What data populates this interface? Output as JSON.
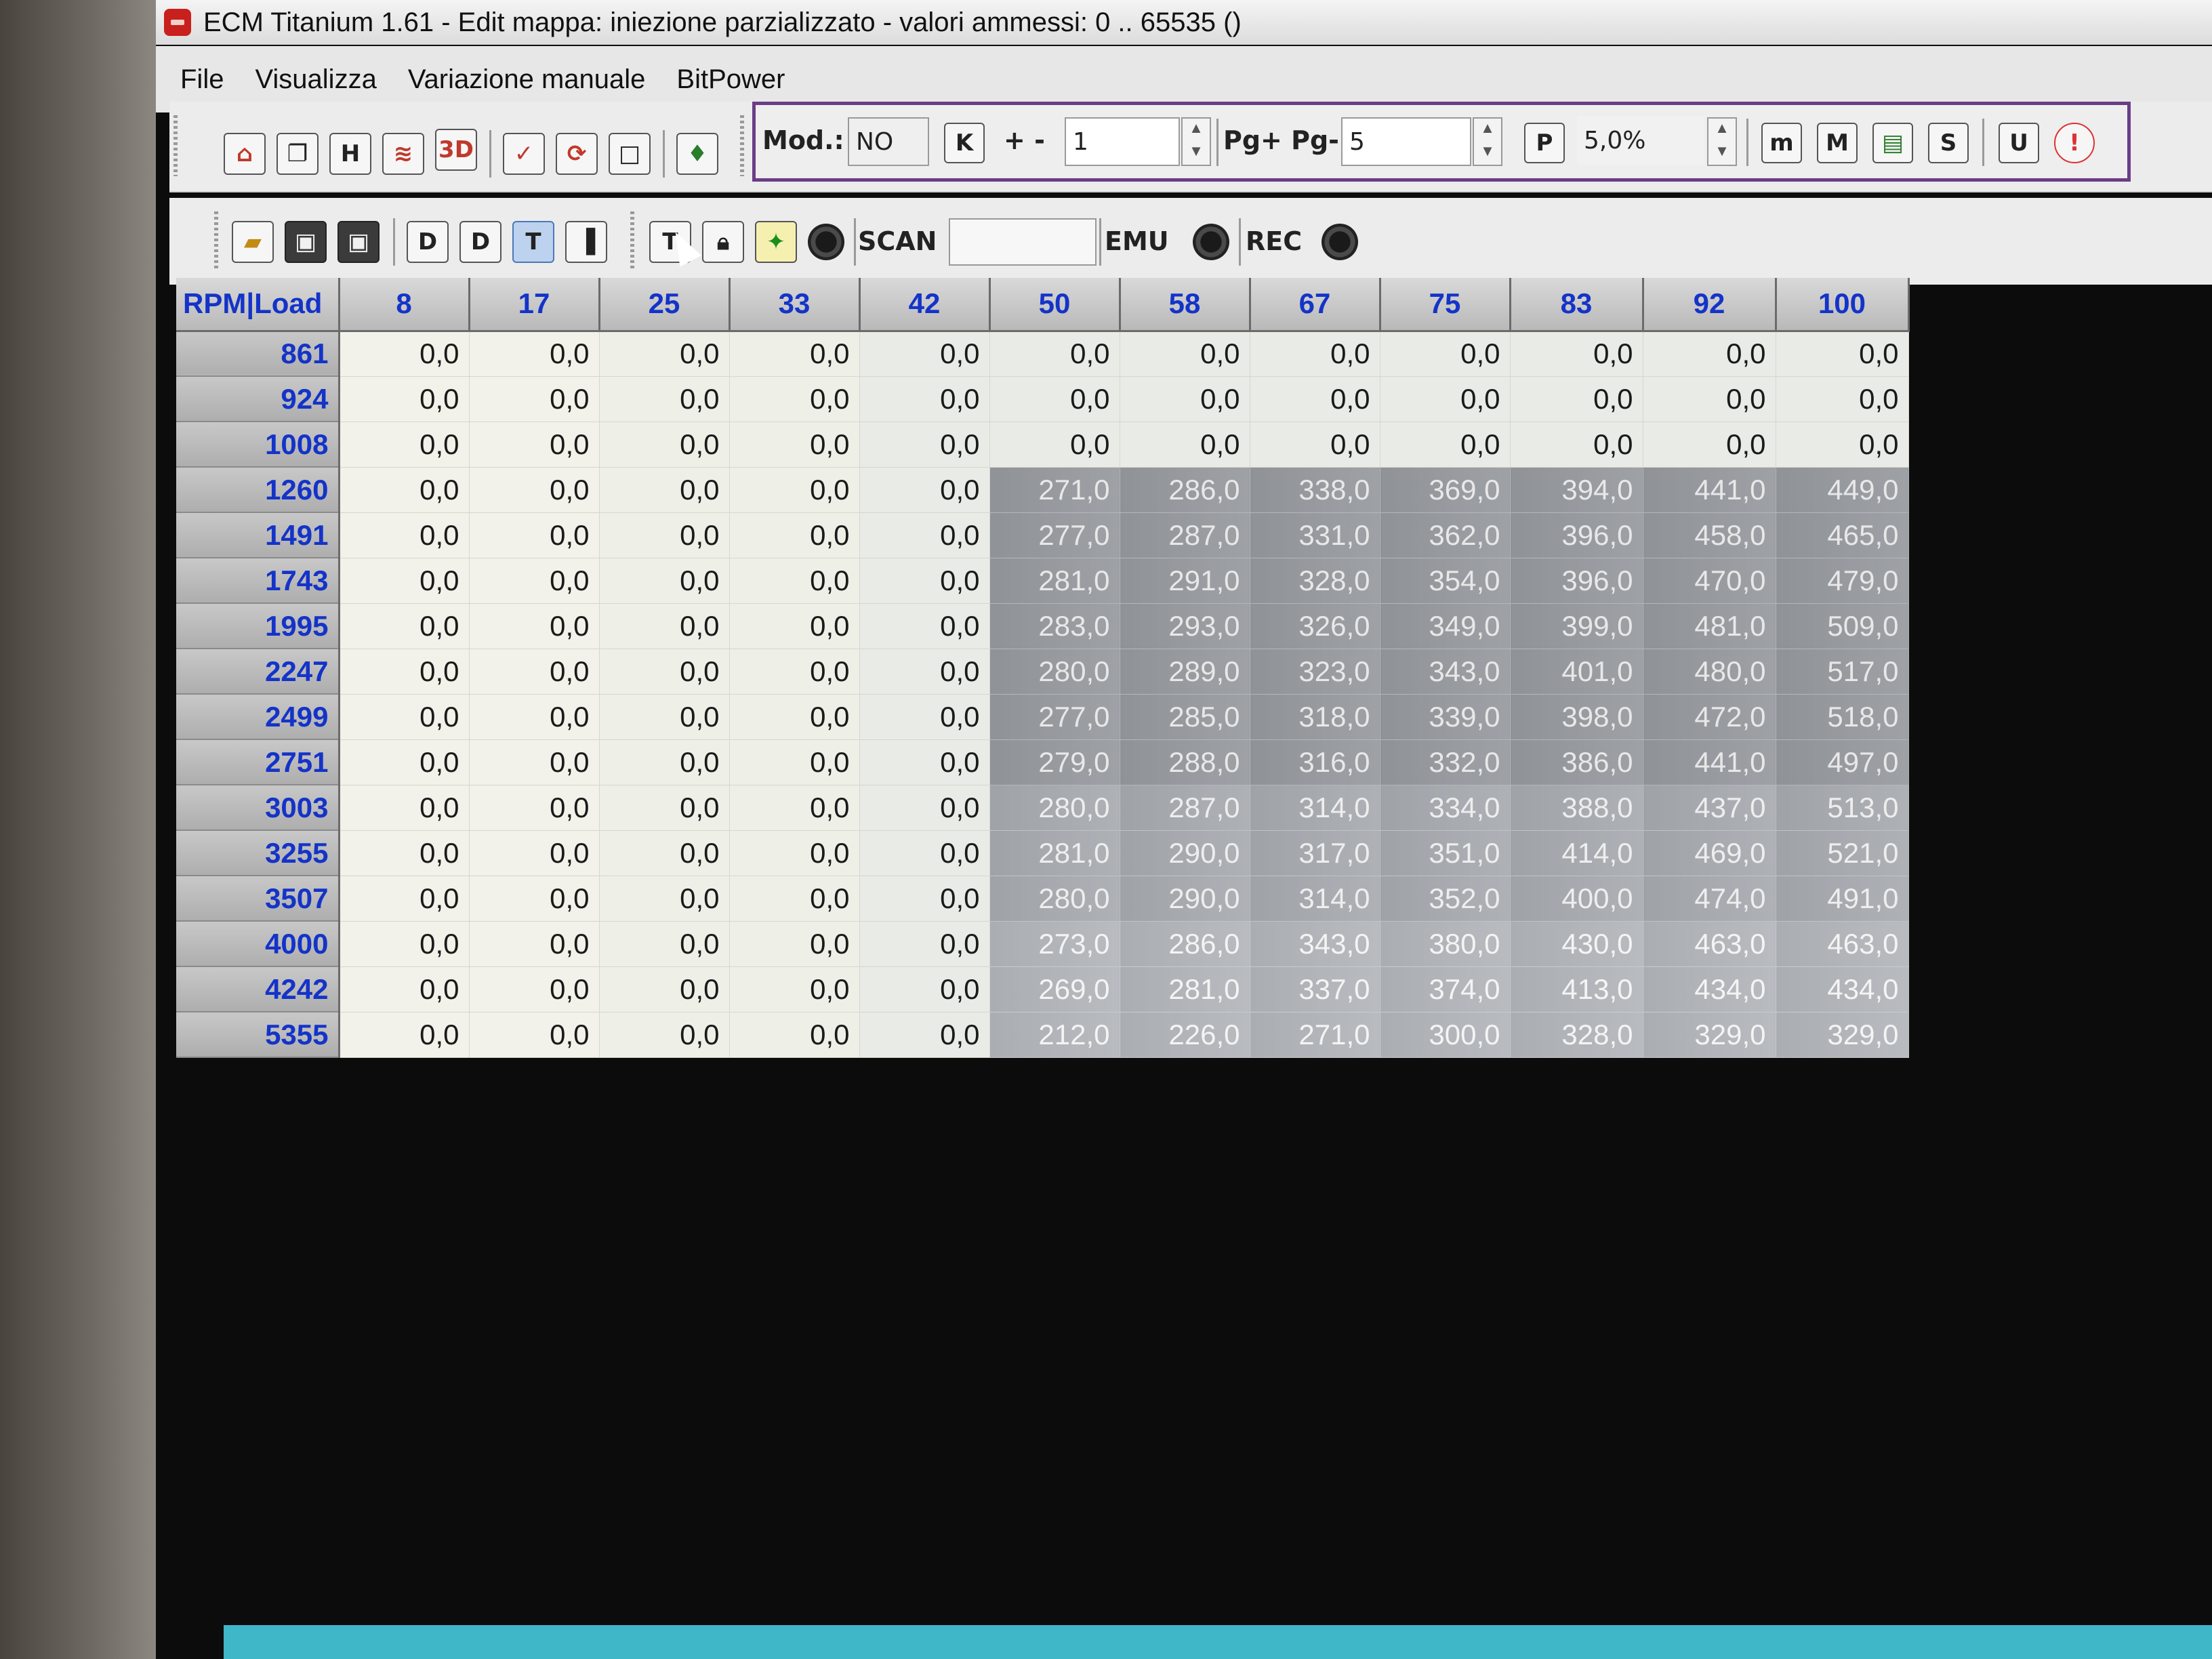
{
  "window": {
    "title": "ECM Titanium 1.61 - Edit mappa: iniezione parzializzato - valori ammessi: 0 .. 65535 ()"
  },
  "menu": [
    "File",
    "Visualizza",
    "Variazione manuale",
    "BitPower"
  ],
  "toolbar1": {
    "icons": [
      "home-icon",
      "windows-icon",
      "hex-icon",
      "chart-icon",
      "3d-view-icon",
      "checklist-icon",
      "compare-icon",
      "map-icon",
      "color-icon"
    ],
    "mod_label": "Mod.:",
    "mod_value": "NO",
    "k_label": "K",
    "plusminus_label": "+ -",
    "plusminus_value": "1",
    "page_label": "Pg+ Pg-",
    "page_value": "5",
    "percent_icon": "P",
    "percent_value": "5,0%",
    "right_buttons": [
      "m",
      "M",
      "graph",
      "S",
      "U"
    ],
    "alert_icon": "!"
  },
  "toolbar2": {
    "icons": [
      "open-icon",
      "save-icon",
      "save-as-icon",
      "d-icon",
      "d2-icon",
      "t-icon",
      "column-icon",
      "t-text-icon",
      "lock-icon",
      "run-icon"
    ],
    "scan_label": "SCAN",
    "scan_value": "",
    "emu_label": "EMU",
    "rec_label": "REC"
  },
  "table": {
    "corner_label": "RPM|Load",
    "columns": [
      "8",
      "17",
      "25",
      "33",
      "42",
      "50",
      "58",
      "67",
      "75",
      "83",
      "92",
      "100"
    ],
    "rows": [
      {
        "rpm": "861",
        "values": [
          "0,0",
          "0,0",
          "0,0",
          "0,0",
          "0,0",
          "0,0",
          "0,0",
          "0,0",
          "0,0",
          "0,0",
          "0,0",
          "0,0"
        ]
      },
      {
        "rpm": "924",
        "values": [
          "0,0",
          "0,0",
          "0,0",
          "0,0",
          "0,0",
          "0,0",
          "0,0",
          "0,0",
          "0,0",
          "0,0",
          "0,0",
          "0,0"
        ]
      },
      {
        "rpm": "1008",
        "values": [
          "0,0",
          "0,0",
          "0,0",
          "0,0",
          "0,0",
          "0,0",
          "0,0",
          "0,0",
          "0,0",
          "0,0",
          "0,0",
          "0,0"
        ]
      },
      {
        "rpm": "1260",
        "values": [
          "0,0",
          "0,0",
          "0,0",
          "0,0",
          "0,0",
          "271,0",
          "286,0",
          "338,0",
          "369,0",
          "394,0",
          "441,0",
          "449,0"
        ]
      },
      {
        "rpm": "1491",
        "values": [
          "0,0",
          "0,0",
          "0,0",
          "0,0",
          "0,0",
          "277,0",
          "287,0",
          "331,0",
          "362,0",
          "396,0",
          "458,0",
          "465,0"
        ]
      },
      {
        "rpm": "1743",
        "values": [
          "0,0",
          "0,0",
          "0,0",
          "0,0",
          "0,0",
          "281,0",
          "291,0",
          "328,0",
          "354,0",
          "396,0",
          "470,0",
          "479,0"
        ]
      },
      {
        "rpm": "1995",
        "values": [
          "0,0",
          "0,0",
          "0,0",
          "0,0",
          "0,0",
          "283,0",
          "293,0",
          "326,0",
          "349,0",
          "399,0",
          "481,0",
          "509,0"
        ]
      },
      {
        "rpm": "2247",
        "values": [
          "0,0",
          "0,0",
          "0,0",
          "0,0",
          "0,0",
          "280,0",
          "289,0",
          "323,0",
          "343,0",
          "401,0",
          "480,0",
          "517,0"
        ]
      },
      {
        "rpm": "2499",
        "values": [
          "0,0",
          "0,0",
          "0,0",
          "0,0",
          "0,0",
          "277,0",
          "285,0",
          "318,0",
          "339,0",
          "398,0",
          "472,0",
          "518,0"
        ]
      },
      {
        "rpm": "2751",
        "values": [
          "0,0",
          "0,0",
          "0,0",
          "0,0",
          "0,0",
          "279,0",
          "288,0",
          "316,0",
          "332,0",
          "386,0",
          "441,0",
          "497,0"
        ]
      },
      {
        "rpm": "3003",
        "values": [
          "0,0",
          "0,0",
          "0,0",
          "0,0",
          "0,0",
          "280,0",
          "287,0",
          "314,0",
          "334,0",
          "388,0",
          "437,0",
          "513,0"
        ]
      },
      {
        "rpm": "3255",
        "values": [
          "0,0",
          "0,0",
          "0,0",
          "0,0",
          "0,0",
          "281,0",
          "290,0",
          "317,0",
          "351,0",
          "414,0",
          "469,0",
          "521,0"
        ]
      },
      {
        "rpm": "3507",
        "values": [
          "0,0",
          "0,0",
          "0,0",
          "0,0",
          "0,0",
          "280,0",
          "290,0",
          "314,0",
          "352,0",
          "400,0",
          "474,0",
          "491,0"
        ]
      },
      {
        "rpm": "4000",
        "values": [
          "0,0",
          "0,0",
          "0,0",
          "0,0",
          "0,0",
          "273,0",
          "286,0",
          "343,0",
          "380,0",
          "430,0",
          "463,0",
          "463,0"
        ]
      },
      {
        "rpm": "4242",
        "values": [
          "0,0",
          "0,0",
          "0,0",
          "0,0",
          "0,0",
          "269,0",
          "281,0",
          "337,0",
          "374,0",
          "413,0",
          "434,0",
          "434,0"
        ]
      },
      {
        "rpm": "5355",
        "values": [
          "0,0",
          "0,0",
          "0,0",
          "0,0",
          "0,0",
          "212,0",
          "226,0",
          "271,0",
          "300,0",
          "328,0",
          "329,0",
          "329,0"
        ]
      }
    ]
  }
}
